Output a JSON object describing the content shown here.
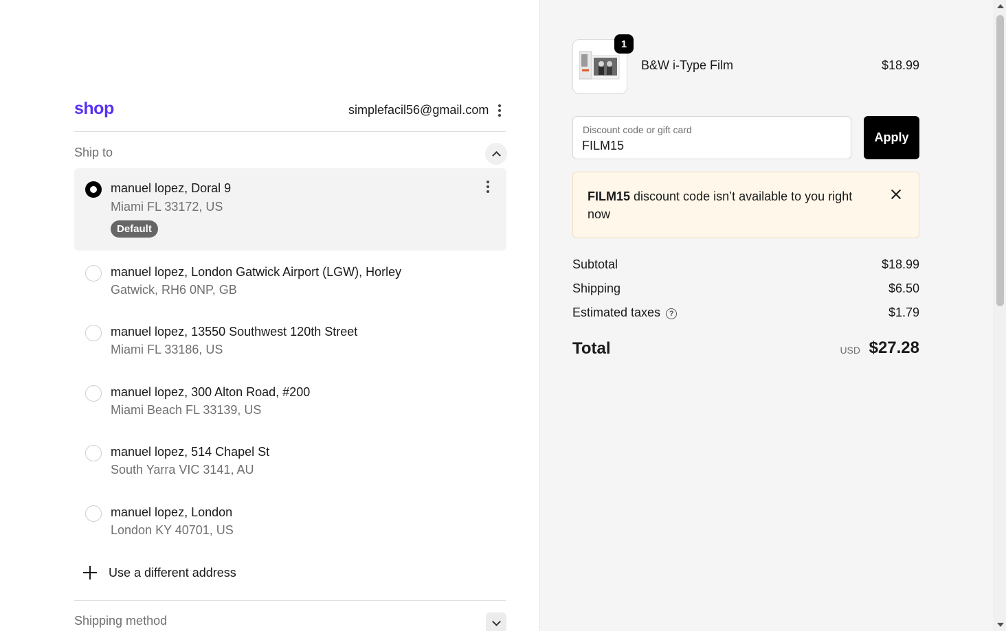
{
  "header": {
    "logo_text": "shop",
    "account_email": "simplefacil56@gmail.com"
  },
  "ship_to": {
    "title": "Ship to",
    "addresses": [
      {
        "line1": "manuel lopez, Doral 9",
        "line2": "Miami FL 33172, US",
        "badge": "Default",
        "selected": true
      },
      {
        "line1": "manuel lopez, London Gatwick Airport (LGW), Horley",
        "line2": "Gatwick, RH6 0NP, GB",
        "selected": false
      },
      {
        "line1": "manuel lopez, 13550 Southwest 120th Street",
        "line2": "Miami FL 33186, US",
        "selected": false
      },
      {
        "line1": "manuel lopez, 300 Alton Road, #200",
        "line2": "Miami Beach FL 33139, US",
        "selected": false
      },
      {
        "line1": "manuel lopez, 514 Chapel St",
        "line2": "South Yarra VIC 3141, AU",
        "selected": false
      },
      {
        "line1": "manuel lopez, London",
        "line2": "London KY 40701, US",
        "selected": false
      }
    ],
    "add_address_label": "Use a different address"
  },
  "shipping_method": {
    "title": "Shipping method"
  },
  "cart": {
    "product": {
      "name": "B&W i-Type Film",
      "price": "$18.99",
      "quantity": "1"
    }
  },
  "discount": {
    "label": "Discount code or gift card",
    "value": "FILM15",
    "apply_label": "Apply",
    "alert_code": "FILM15",
    "alert_text": " discount code isn’t available to you right now"
  },
  "summary": {
    "subtotal_label": "Subtotal",
    "subtotal_value": "$18.99",
    "shipping_label": "Shipping",
    "shipping_value": "$6.50",
    "taxes_label": "Estimated taxes",
    "taxes_value": "$1.79",
    "total_label": "Total",
    "currency": "USD",
    "total_value": "$27.28"
  },
  "colors": {
    "brand": "#5a31f4",
    "summary_bg": "#f5f5f5",
    "alert_bg": "#fff7ea"
  }
}
